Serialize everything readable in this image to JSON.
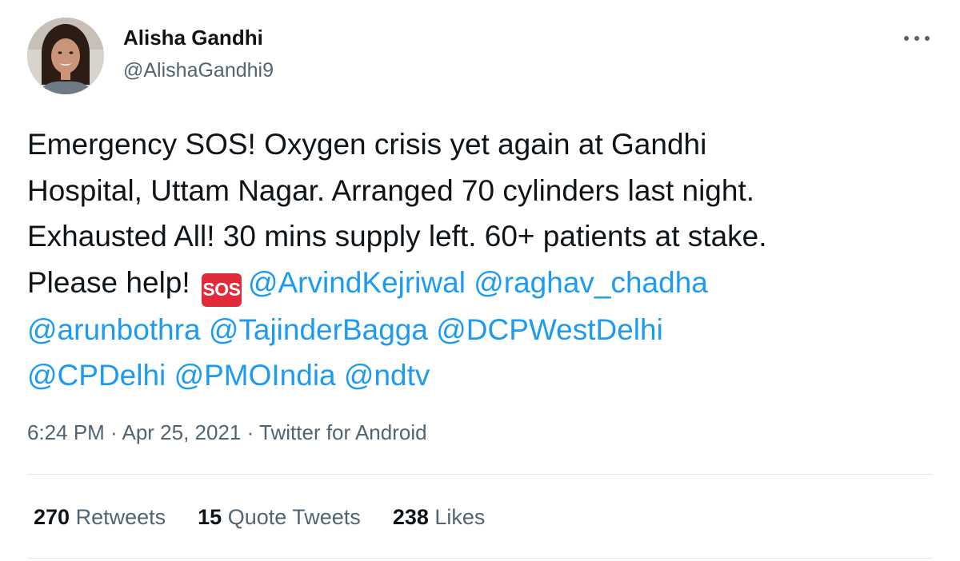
{
  "author": {
    "name": "Alisha Gandhi",
    "handle": "@AlishaGandhi9"
  },
  "tweet": {
    "lines": [
      [
        {
          "t": "Emergency SOS! Oxygen crisis yet again at Gandhi"
        }
      ],
      [
        {
          "t": "Hospital, Uttam Nagar. Arranged 70 cylinders last night."
        }
      ],
      [
        {
          "t": "Exhausted All! 30 mins supply left. 60+ patients at stake."
        }
      ],
      [
        {
          "t": "Please help! "
        },
        {
          "emoji": "SOS"
        },
        {
          "m": "@ArvindKejriwal"
        },
        {
          "t": " "
        },
        {
          "m": "@raghav_chadha"
        }
      ],
      [
        {
          "m": "@arunbothra"
        },
        {
          "t": " "
        },
        {
          "m": "@TajinderBagga"
        },
        {
          "t": " "
        },
        {
          "m": "@DCPWestDelhi"
        }
      ],
      [
        {
          "m": "@CPDelhi"
        },
        {
          "t": " "
        },
        {
          "m": "@PMOIndia"
        },
        {
          "t": " "
        },
        {
          "m": "@ndtv"
        }
      ]
    ]
  },
  "meta": {
    "time": "6:24 PM",
    "sep1": " · ",
    "date": "Apr 25, 2021",
    "sep2": " · ",
    "source": "Twitter for Android"
  },
  "stats": {
    "retweets": {
      "count": "270",
      "label": "Retweets"
    },
    "quotes": {
      "count": "15",
      "label": "Quote Tweets"
    },
    "likes": {
      "count": "238",
      "label": "Likes"
    }
  },
  "icons": {
    "more": "more-horizontal-icon",
    "sos": "sos-emoji-icon"
  },
  "colors": {
    "mention": "#1d9bf0",
    "secondary": "#536471",
    "sos_badge": "#e22b3a"
  }
}
